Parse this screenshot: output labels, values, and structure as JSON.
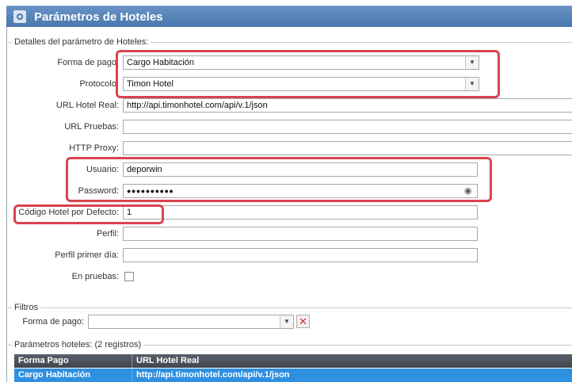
{
  "window": {
    "title": "Parámetros de Hoteles"
  },
  "details": {
    "legend": "Detalles del parámetro de Hoteles:",
    "forma_pago": {
      "label": "Forma de pago:",
      "value": "Cargo Habitación"
    },
    "protocolo": {
      "label": "Protocolo:",
      "value": "Timon Hotel"
    },
    "url_real": {
      "label": "URL Hotel Real:",
      "value": "http://api.timonhotel.com/api/v.1/json"
    },
    "url_pruebas": {
      "label": "URL Pruebas:",
      "value": ""
    },
    "http_proxy": {
      "label": "HTTP Proxy:",
      "value": ""
    },
    "usuario": {
      "label": "Usuario:",
      "value": "deporwin"
    },
    "password": {
      "label": "Password:",
      "value": "●●●●●●●●●●"
    },
    "codigo_hotel": {
      "label": "Código Hotel por Defecto:",
      "value": "1"
    },
    "perfil": {
      "label": "Perfil:",
      "value": ""
    },
    "perfil_primer_dia": {
      "label": "Perfil primer día:",
      "value": ""
    },
    "en_pruebas": {
      "label": "En pruebas:",
      "checked": false
    }
  },
  "filters": {
    "legend": "Filtros",
    "forma_pago": {
      "label": "Forma de pago:",
      "value": ""
    }
  },
  "grid": {
    "legend": "Parámetros hoteles: (2 registros)",
    "columns": [
      "Forma Pago",
      "URL Hotel Real"
    ],
    "rows": [
      {
        "forma_pago": "Cargo Habitación",
        "url": "http://api.timonhotel.com/api/v.1/json"
      }
    ]
  },
  "colors": {
    "highlight": "#d9444f",
    "header": "#4a77ad",
    "selected_row": "#2f8fe0"
  }
}
